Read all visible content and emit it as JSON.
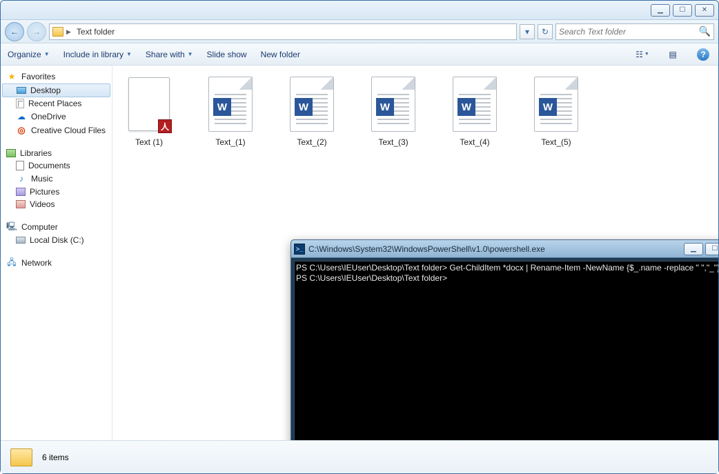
{
  "window": {
    "min": "▁",
    "max": "☐",
    "close": "✕"
  },
  "address": {
    "crumb": "Text folder",
    "sep": "▶",
    "dropdown": "▾",
    "refresh": "↻"
  },
  "search": {
    "placeholder": "Search Text folder",
    "mag": "🔍"
  },
  "toolbar": {
    "organize": "Organize",
    "include": "Include in library",
    "share": "Share with",
    "slideshow": "Slide show",
    "newfolder": "New folder"
  },
  "nav": {
    "favorites": "Favorites",
    "desktop": "Desktop",
    "recent": "Recent Places",
    "onedrive": "OneDrive",
    "cc": "Creative Cloud Files",
    "libraries": "Libraries",
    "documents": "Documents",
    "music": "Music",
    "pictures": "Pictures",
    "videos": "Videos",
    "computer": "Computer",
    "localdisk": "Local Disk (C:)",
    "network": "Network"
  },
  "files": [
    {
      "name": "Text (1)",
      "type": "pdf"
    },
    {
      "name": "Text_(1)",
      "type": "docx"
    },
    {
      "name": "Text_(2)",
      "type": "docx"
    },
    {
      "name": "Text_(3)",
      "type": "docx"
    },
    {
      "name": "Text_(4)",
      "type": "docx"
    },
    {
      "name": "Text_(5)",
      "type": "docx"
    }
  ],
  "status": {
    "count": "6 items"
  },
  "ps": {
    "title": "C:\\Windows\\System32\\WindowsPowerShell\\v1.0\\powershell.exe",
    "line1": "PS C:\\Users\\IEUser\\Desktop\\Text folder> Get-ChildItem *docx | Rename-Item -NewName {$_.name -replace \" \",\"_\"}",
    "line2": "PS C:\\Users\\IEUser\\Desktop\\Text folder>",
    "min": "▁",
    "max": "☐",
    "close": "✕",
    "up": "▲",
    "down": "▼"
  }
}
